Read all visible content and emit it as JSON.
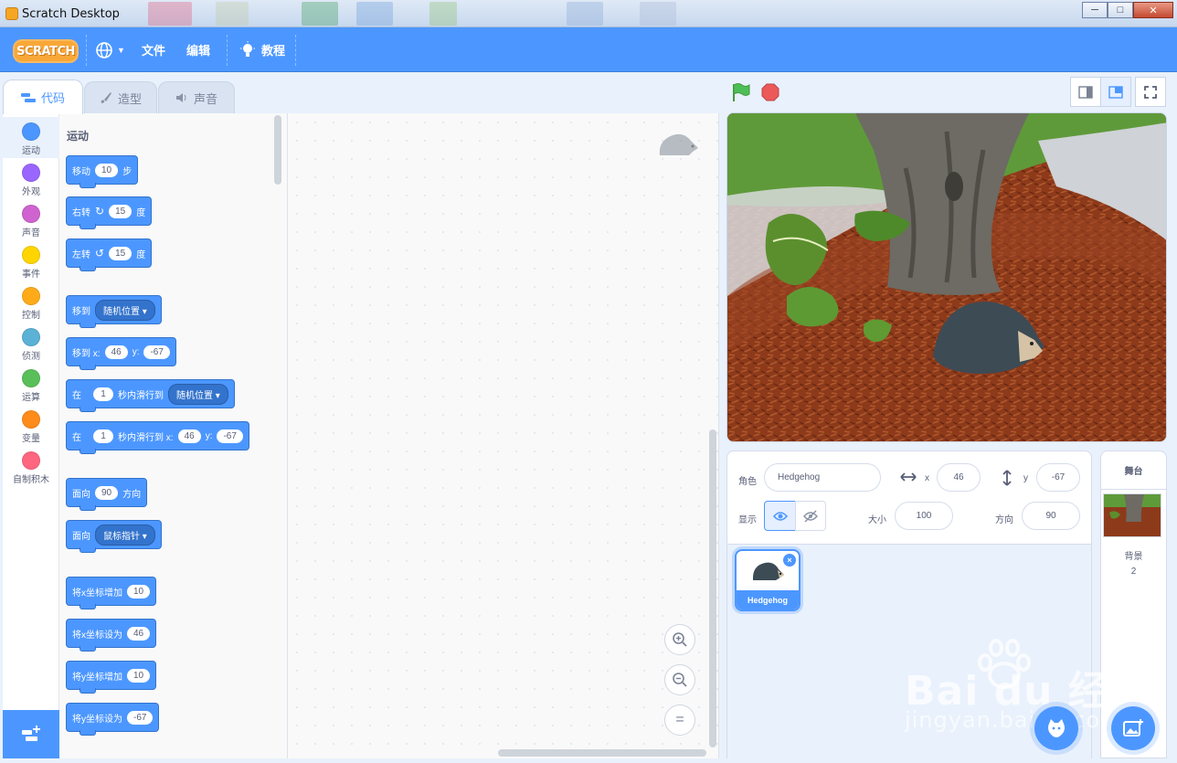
{
  "window": {
    "title": "Scratch Desktop",
    "minimize": "─",
    "maximize": "□",
    "close": "✕"
  },
  "menubar": {
    "logo": "SCRATCH",
    "file": "文件",
    "edit": "编辑",
    "tutorials": "教程"
  },
  "tabs": [
    {
      "label": "代码",
      "icon": "code-icon"
    },
    {
      "label": "造型",
      "icon": "brush-icon"
    },
    {
      "label": "声音",
      "icon": "speaker-icon"
    }
  ],
  "categories": [
    {
      "label": "运动",
      "color": "#4c97ff"
    },
    {
      "label": "外观",
      "color": "#9966ff"
    },
    {
      "label": "声音",
      "color": "#cf63cf"
    },
    {
      "label": "事件",
      "color": "#ffd500"
    },
    {
      "label": "控制",
      "color": "#ffab19"
    },
    {
      "label": "侦测",
      "color": "#5cb1d6"
    },
    {
      "label": "运算",
      "color": "#59c059"
    },
    {
      "label": "变量",
      "color": "#ff8c1a"
    },
    {
      "label": "自制积木",
      "color": "#ff6680"
    }
  ],
  "palette": {
    "heading": "运动",
    "blocks": {
      "move": {
        "a": "移动",
        "v": "10",
        "b": "步"
      },
      "turn_right": {
        "a": "右转",
        "v": "15",
        "b": "度"
      },
      "turn_left": {
        "a": "左转",
        "v": "15",
        "b": "度"
      },
      "goto": {
        "a": "移到",
        "dd": "随机位置"
      },
      "goto_xy": {
        "a": "移到 x:",
        "x": "46",
        "ylbl": "y:",
        "y": "-67"
      },
      "glide": {
        "a": "在",
        "v": "1",
        "b": "秒内滑行到",
        "dd": "随机位置"
      },
      "glide_xy": {
        "a": "在",
        "v": "1",
        "b": "秒内滑行到 x:",
        "x": "46",
        "ylbl": "y:",
        "y": "-67"
      },
      "point_dir": {
        "a": "面向",
        "v": "90",
        "b": "方向"
      },
      "point_towards": {
        "a": "面向",
        "dd": "鼠标指针"
      },
      "change_x": {
        "a": "将x坐标增加",
        "v": "10"
      },
      "set_x": {
        "a": "将x坐标设为",
        "v": "46"
      },
      "change_y": {
        "a": "将y坐标增加",
        "v": "10"
      },
      "set_y": {
        "a": "将y坐标设为",
        "v": "-67"
      }
    }
  },
  "zoom": {
    "in": "+",
    "out": "−",
    "reset": "="
  },
  "sprite_info": {
    "sprite_label": "角色",
    "sprite_name": "Hedgehog",
    "x_label": "x",
    "x": "46",
    "y_label": "y",
    "y": "-67",
    "show_label": "显示",
    "size_label": "大小",
    "size": "100",
    "direction_label": "方向",
    "direction": "90"
  },
  "sprites": [
    {
      "name": "Hedgehog",
      "selected": true
    }
  ],
  "stage_pane": {
    "title": "舞台",
    "backdrops_label": "背景",
    "backdrops_count": "2"
  },
  "watermark": {
    "brand": "Bai du 经验",
    "url": "jingyan.baidu.com"
  },
  "colors": {
    "accent": "#4c97ff",
    "menubar": "#4c97ff",
    "motion": "#4c97ff",
    "green_flag": "#4cbf56",
    "stop": "#ec5959"
  }
}
